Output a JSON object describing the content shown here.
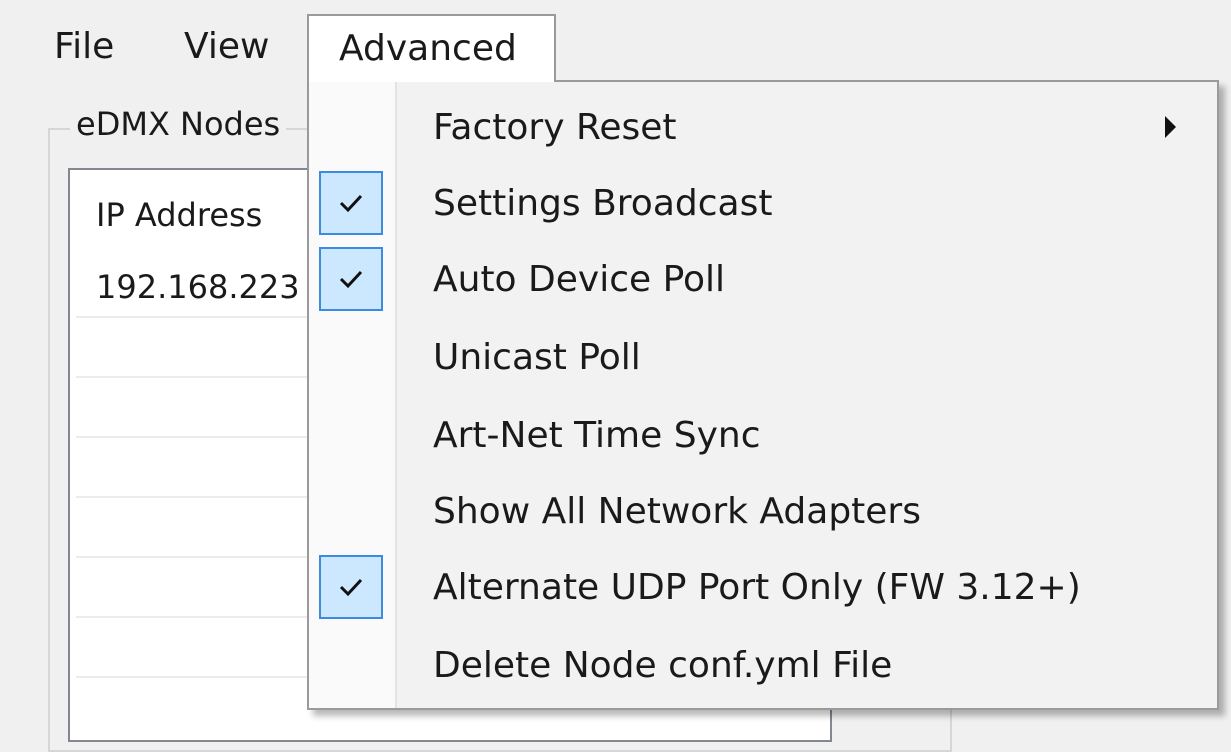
{
  "menubar": {
    "file_label": "File",
    "view_label": "View",
    "advanced_label": "Advanced"
  },
  "nodes_panel": {
    "group_label": "eDMX Nodes",
    "column_header": "IP Address",
    "rows": [
      "192.168.223"
    ]
  },
  "advanced_menu": {
    "items": [
      {
        "label": "Factory Reset",
        "checked": false,
        "has_submenu": true
      },
      {
        "label": "Settings Broadcast",
        "checked": true,
        "has_submenu": false
      },
      {
        "label": "Auto Device Poll",
        "checked": true,
        "has_submenu": false
      },
      {
        "label": "Unicast Poll",
        "checked": false,
        "has_submenu": false
      },
      {
        "label": "Art-Net Time Sync",
        "checked": false,
        "has_submenu": false
      },
      {
        "label": "Show All Network Adapters",
        "checked": false,
        "has_submenu": false
      },
      {
        "label": "Alternate UDP Port Only (FW 3.12+)",
        "checked": true,
        "has_submenu": false
      },
      {
        "label": "Delete Node conf.yml File",
        "checked": false,
        "has_submenu": false
      }
    ]
  },
  "colors": {
    "check_fill": "#cce8ff",
    "check_border": "#3d8be0",
    "menu_background": "#f2f2f2"
  },
  "icons": {
    "check": "checkmark-icon",
    "submenu": "submenu-arrow-icon"
  }
}
